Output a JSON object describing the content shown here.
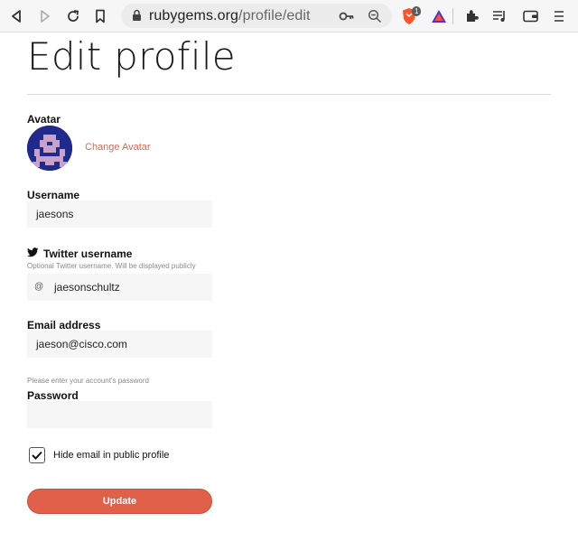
{
  "browser": {
    "url_host": "rubygems.org",
    "url_path": "/profile/edit",
    "brave_badge_count": "1"
  },
  "page": {
    "title": "Edit profile"
  },
  "avatar": {
    "label": "Avatar",
    "change_link": "Change Avatar"
  },
  "username": {
    "label": "Username",
    "value": "jaesons"
  },
  "twitter": {
    "label": "Twitter username",
    "hint": "Optional Twitter username. Will be displayed publicly",
    "prefix": "@",
    "value": "jaesonschultz"
  },
  "email": {
    "label": "Email address",
    "value": "jaeson@cisco.com"
  },
  "password": {
    "hint": "Please enter your account's password",
    "label": "Password",
    "value": ""
  },
  "hide_email": {
    "label": "Hide email in public profile",
    "checked": true
  },
  "submit": {
    "label": "Update"
  },
  "colors": {
    "accent": "#e0604a",
    "avatar_bg": "#1f2a8c"
  }
}
